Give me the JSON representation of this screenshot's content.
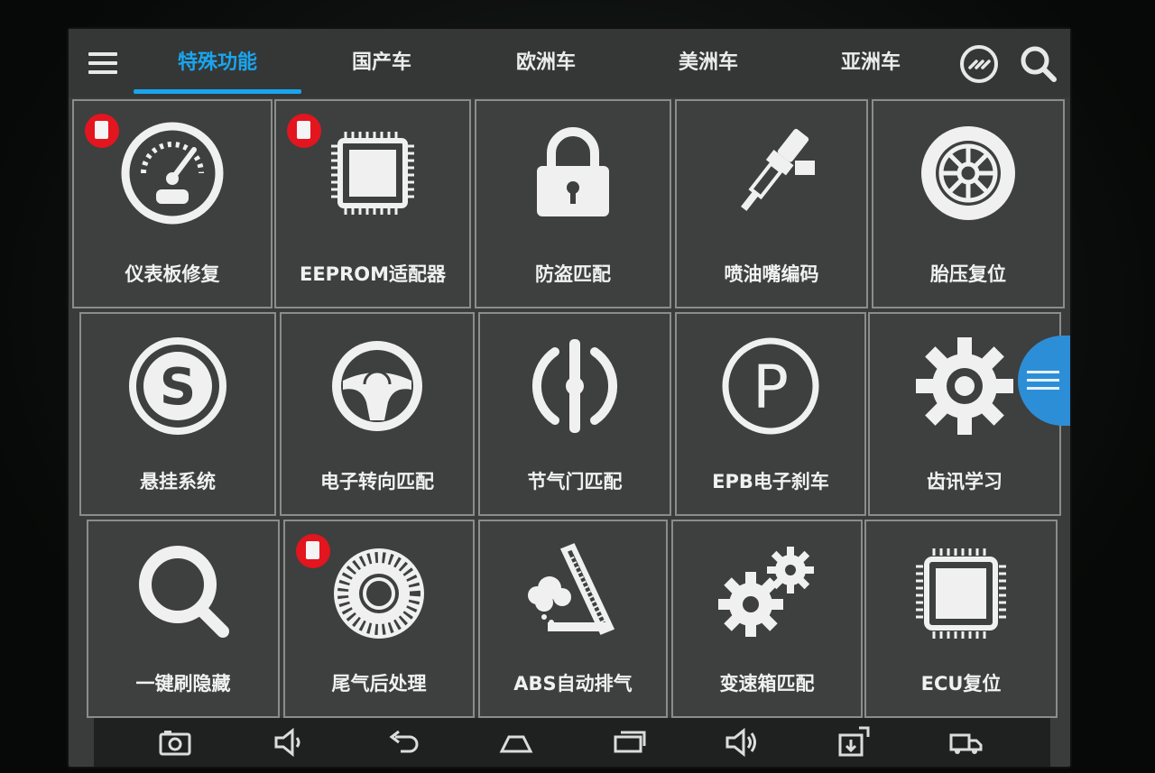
{
  "tabs": [
    {
      "label": "特殊功能",
      "active": true
    },
    {
      "label": "国产车",
      "active": false
    },
    {
      "label": "欧洲车",
      "active": false
    },
    {
      "label": "美洲车",
      "active": false
    },
    {
      "label": "亚洲车",
      "active": false
    }
  ],
  "tiles": [
    {
      "label": "仪表板修复",
      "icon": "gauge-icon",
      "badge": true
    },
    {
      "label": "EEPROM适配器",
      "icon": "chip-icon",
      "badge": true
    },
    {
      "label": "防盗匹配",
      "icon": "lock-icon",
      "badge": false
    },
    {
      "label": "喷油嘴编码",
      "icon": "injector-icon",
      "badge": false
    },
    {
      "label": "胎压复位",
      "icon": "tire-icon",
      "badge": false
    },
    {
      "label": "悬挂系统",
      "icon": "suspension-icon",
      "badge": false
    },
    {
      "label": "电子转向匹配",
      "icon": "steering-wheel-icon",
      "badge": false
    },
    {
      "label": "节气门匹配",
      "icon": "throttle-icon",
      "badge": false
    },
    {
      "label": "EPB电子刹车",
      "icon": "parking-brake-icon",
      "badge": false
    },
    {
      "label": "齿讯学习",
      "icon": "gear-icon",
      "badge": false
    },
    {
      "label": "一键刷隐藏",
      "icon": "search-icon",
      "badge": false
    },
    {
      "label": "尾气后处理",
      "icon": "exhaust-filter-icon",
      "badge": true
    },
    {
      "label": "ABS自动排气",
      "icon": "abs-bleed-icon",
      "badge": false
    },
    {
      "label": "变速箱匹配",
      "icon": "gears-icon",
      "badge": false
    },
    {
      "label": "ECU复位",
      "icon": "ecu-chip-icon",
      "badge": false
    }
  ],
  "colors": {
    "accent": "#19a5ee",
    "badge": "#e3151e",
    "tile_bg": "#3d403f"
  }
}
